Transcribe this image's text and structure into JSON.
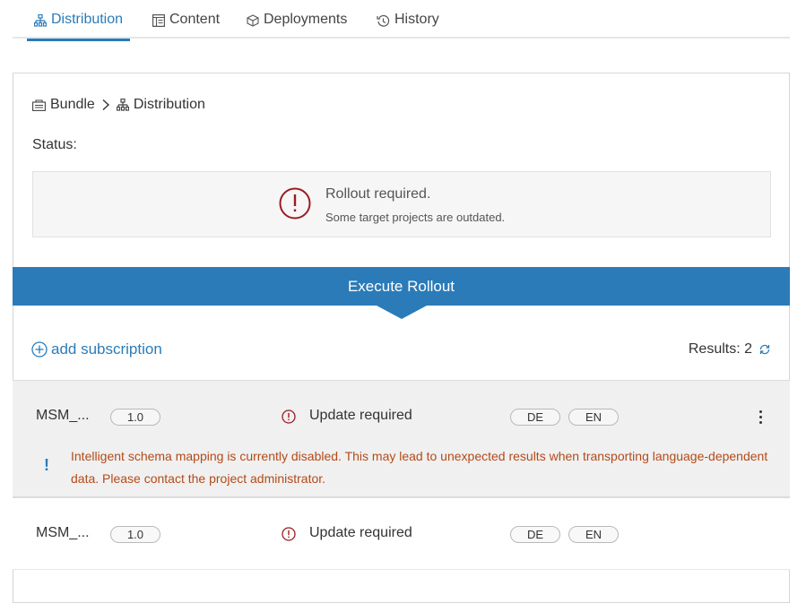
{
  "tabs": [
    {
      "label": "Distribution",
      "icon": "sitemap-icon",
      "active": true
    },
    {
      "label": "Content",
      "icon": "layout-icon",
      "active": false
    },
    {
      "label": "Deployments",
      "icon": "cube-icon",
      "active": false
    },
    {
      "label": "History",
      "icon": "history-icon",
      "active": false
    }
  ],
  "breadcrumb": [
    {
      "label": "Bundle",
      "icon": "bundle-icon"
    },
    {
      "label": "Distribution",
      "icon": "sitemap-icon"
    }
  ],
  "status": {
    "label": "Status:",
    "title": "Rollout required.",
    "subtitle": "Some target projects are outdated."
  },
  "rollout_button": "Execute Rollout",
  "add_subscription": "add subscription",
  "results": "Results: 2",
  "rows": [
    {
      "name": "MSM_...",
      "version": "1.0",
      "status": "Update required",
      "languages": [
        "DE",
        "EN"
      ],
      "warning": "Intelligent schema mapping is currently disabled. This may lead to unexpected results when transporting language-dependent data. Please contact the project administrator.",
      "warning_mark": "!"
    },
    {
      "name": "MSM_...",
      "version": "1.0",
      "status": "Update required",
      "languages": [
        "DE",
        "EN"
      ]
    }
  ],
  "colors": {
    "accent": "#2b7bb9",
    "error": "#9b1c22",
    "warning_text": "#b44a18"
  }
}
